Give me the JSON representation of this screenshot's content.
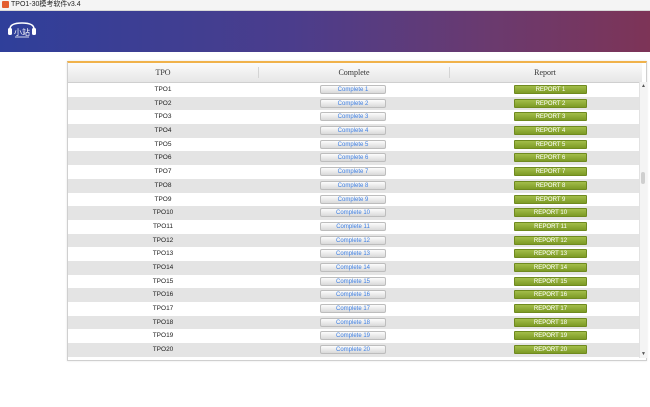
{
  "window": {
    "title": "TPO1-30模考软件v3.4"
  },
  "logo": {
    "text": "小站"
  },
  "table": {
    "columns": [
      "TPO",
      "Complete",
      "Report"
    ],
    "rows": [
      {
        "tpo": "TPO1",
        "complete": "Complete 1",
        "report": "REPORT 1"
      },
      {
        "tpo": "TPO2",
        "complete": "Complete 2",
        "report": "REPORT 2"
      },
      {
        "tpo": "TPO3",
        "complete": "Complete 3",
        "report": "REPORT 3"
      },
      {
        "tpo": "TPO4",
        "complete": "Complete 4",
        "report": "REPORT 4"
      },
      {
        "tpo": "TPO5",
        "complete": "Complete 5",
        "report": "REPORT 5"
      },
      {
        "tpo": "TPO6",
        "complete": "Complete 6",
        "report": "REPORT 6"
      },
      {
        "tpo": "TPO7",
        "complete": "Complete 7",
        "report": "REPORT 7"
      },
      {
        "tpo": "TPO8",
        "complete": "Complete 8",
        "report": "REPORT 8"
      },
      {
        "tpo": "TPO9",
        "complete": "Complete 9",
        "report": "REPORT 9"
      },
      {
        "tpo": "TPO10",
        "complete": "Complete 10",
        "report": "REPORT 10"
      },
      {
        "tpo": "TPO11",
        "complete": "Complete 11",
        "report": "REPORT 11"
      },
      {
        "tpo": "TPO12",
        "complete": "Complete 12",
        "report": "REPORT 12"
      },
      {
        "tpo": "TPO13",
        "complete": "Complete 13",
        "report": "REPORT 13"
      },
      {
        "tpo": "TPO14",
        "complete": "Complete 14",
        "report": "REPORT 14"
      },
      {
        "tpo": "TPO15",
        "complete": "Complete 15",
        "report": "REPORT 15"
      },
      {
        "tpo": "TPO16",
        "complete": "Complete 16",
        "report": "REPORT 16"
      },
      {
        "tpo": "TPO17",
        "complete": "Complete 17",
        "report": "REPORT 17"
      },
      {
        "tpo": "TPO18",
        "complete": "Complete 18",
        "report": "REPORT 18"
      },
      {
        "tpo": "TPO19",
        "complete": "Complete 19",
        "report": "REPORT 19"
      },
      {
        "tpo": "TPO20",
        "complete": "Complete 20",
        "report": "REPORT 20"
      }
    ]
  },
  "colors": {
    "banner_start": "#2f3f9a",
    "banner_end": "#7d3457",
    "report_green": "#8aa832",
    "complete_text": "#3d7fe3",
    "header_accent": "#f0b24b"
  },
  "icons": {
    "app": "app-icon",
    "scroll_up": "chevron-up-icon",
    "scroll_down": "chevron-down-icon"
  }
}
